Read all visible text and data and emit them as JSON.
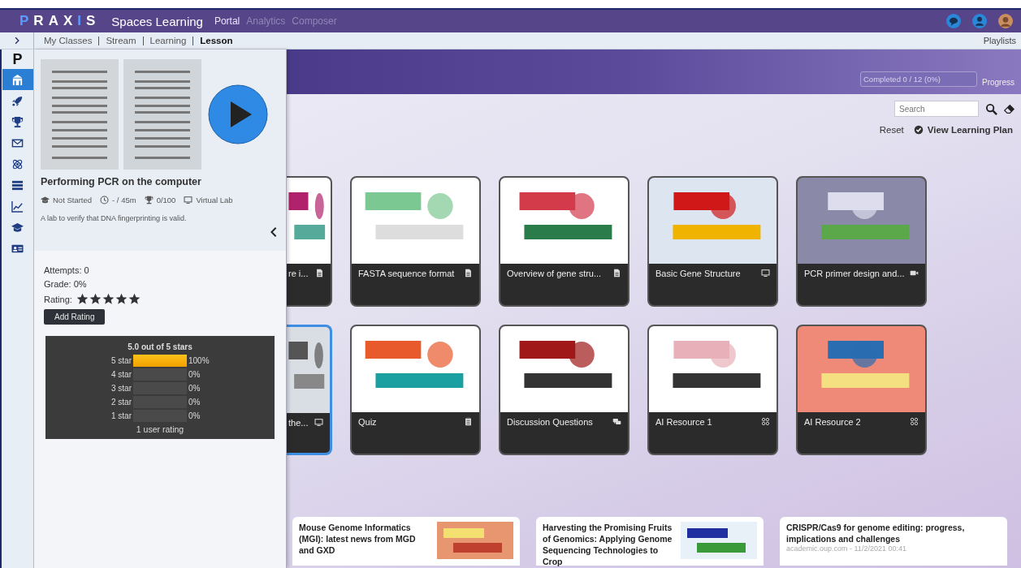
{
  "app_bar": {
    "logo": "PRAXIS",
    "title": "Spaces Learning",
    "nav": [
      {
        "label": "Portal",
        "selected": true
      },
      {
        "label": "Analytics",
        "selected": false
      },
      {
        "label": "Composer",
        "selected": false
      }
    ]
  },
  "breadcrumbs": [
    {
      "label": "My Classes",
      "current": false
    },
    {
      "label": "Stream",
      "current": false
    },
    {
      "label": "Learning",
      "current": false
    },
    {
      "label": "Lesson",
      "current": true
    }
  ],
  "playlists": "Playlists",
  "rail": {
    "logo": "P",
    "items": [
      {
        "kind": "building",
        "selected": true
      },
      {
        "kind": "rocket",
        "selected": false
      },
      {
        "kind": "trophy",
        "selected": false
      },
      {
        "kind": "envelope",
        "selected": false
      },
      {
        "kind": "atom",
        "selected": false
      },
      {
        "kind": "list",
        "selected": false
      },
      {
        "kind": "chart",
        "selected": false
      },
      {
        "kind": "cap",
        "selected": false
      },
      {
        "kind": "idcard",
        "selected": false
      }
    ]
  },
  "progress": {
    "label": "Completed 0 / 12 (0%)",
    "level": 0,
    "link": "Progress"
  },
  "search": {
    "placeholder": "Search"
  },
  "actions": {
    "reset": "Reset",
    "plan": "View Learning Plan"
  },
  "cards": [
    [
      {
        "title": "re i...",
        "kind": "document",
        "selected": false
      },
      {
        "title": "FASTA sequence format",
        "kind": "document",
        "selected": false
      },
      {
        "title": "Overview of gene stru...",
        "kind": "document",
        "selected": false
      },
      {
        "title": "Basic Gene Structure",
        "kind": "monitor",
        "selected": false
      },
      {
        "title": "PCR primer design and...",
        "kind": "video",
        "selected": false
      }
    ],
    [
      {
        "title": "the...",
        "kind": "monitor",
        "selected": true
      },
      {
        "title": "Quiz",
        "kind": "clipboard",
        "selected": false
      },
      {
        "title": "Discussion Questions",
        "kind": "chat",
        "selected": false
      },
      {
        "title": "AI Resource 1",
        "kind": "grid",
        "selected": false
      },
      {
        "title": "AI Resource 2",
        "kind": "grid",
        "selected": false
      }
    ]
  ],
  "news": [
    {
      "title": "Mouse Genome Informatics (MGI): latest news from MGD and GXD"
    },
    {
      "title": "Harvesting the Promising Fruits of Genomics: Applying Genome Sequencing Technologies to Crop"
    },
    {
      "title": "CRISPR/Cas9 for genome editing: progress, implications and challenges",
      "source": "academic.oup.com - 11/2/2021 00:41"
    }
  ],
  "detail": {
    "title": "Performing PCR on the computer",
    "status": "Not Started",
    "time": "- / 45m",
    "score": "0/100",
    "type": "Virtual Lab",
    "description": "A lab to verify that DNA fingerprinting is valid.",
    "attempts": "Attempts: 0",
    "grade": "Grade: 0%",
    "rating_label": "Rating:",
    "stars": 5,
    "add_rating": "Add Rating",
    "summary": {
      "title": "5.0 out of 5 stars",
      "rows": [
        {
          "label": "5 star",
          "level": 1,
          "percent": "100%"
        },
        {
          "label": "4 star",
          "level": 0,
          "percent": "0%"
        },
        {
          "label": "3 star",
          "level": 0,
          "percent": "0%"
        },
        {
          "label": "2 star",
          "level": 0,
          "percent": "0%"
        },
        {
          "label": "1 star",
          "level": 0,
          "percent": "0%"
        }
      ],
      "footer": "1 user rating"
    }
  }
}
